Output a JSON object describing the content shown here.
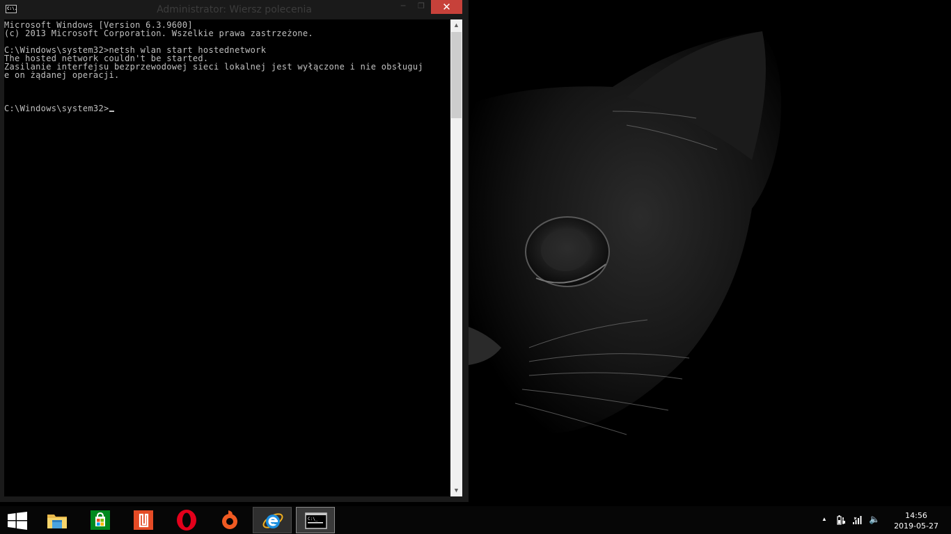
{
  "window": {
    "title": "Administrator: Wiersz polecenia",
    "icon_label": "C:\\.",
    "min_glyph": "─",
    "max_glyph": "❐",
    "close_glyph": "✕"
  },
  "console": {
    "lines": [
      "Microsoft Windows [Version 6.3.9600]",
      "(c) 2013 Microsoft Corporation. Wszelkie prawa zastrzeżone.",
      "",
      "C:\\Windows\\system32>netsh wlan start hostednetwork",
      "The hosted network couldn't be started.",
      "Zasilanie interfejsu bezprzewodowej sieci lokalnej jest wyłączone i nie obsługuj",
      "e on żądanej operacji.",
      "",
      "",
      "",
      "C:\\Windows\\system32>"
    ],
    "scroll_up_glyph": "▲",
    "scroll_down_glyph": "▼"
  },
  "taskbar": {
    "apps": [
      {
        "name": "start-button",
        "icon": "windows-logo-icon"
      },
      {
        "name": "file-explorer",
        "icon": "folder-icon"
      },
      {
        "name": "store",
        "icon": "store-bag-icon"
      },
      {
        "name": "acrobat-reader",
        "icon": "acrobat-icon"
      },
      {
        "name": "opera",
        "icon": "opera-icon"
      },
      {
        "name": "origin",
        "icon": "origin-icon"
      },
      {
        "name": "internet-explorer",
        "icon": "ie-icon"
      },
      {
        "name": "command-prompt",
        "icon": "cmd-icon"
      }
    ],
    "tray": {
      "overflow_glyph": "▲",
      "volume_glyph": "🔈"
    },
    "clock": {
      "time": "14:56",
      "date": "2019-05-27"
    }
  },
  "colors": {
    "close_button": "#c7413a",
    "console_bg": "#000000",
    "console_text": "#c0c0c0",
    "ie_blue": "#1c8fe0",
    "store_green": "#00891e",
    "acrobat_red": "#e44b26",
    "opera_red": "#e3001b",
    "origin_orange": "#f05a22"
  }
}
